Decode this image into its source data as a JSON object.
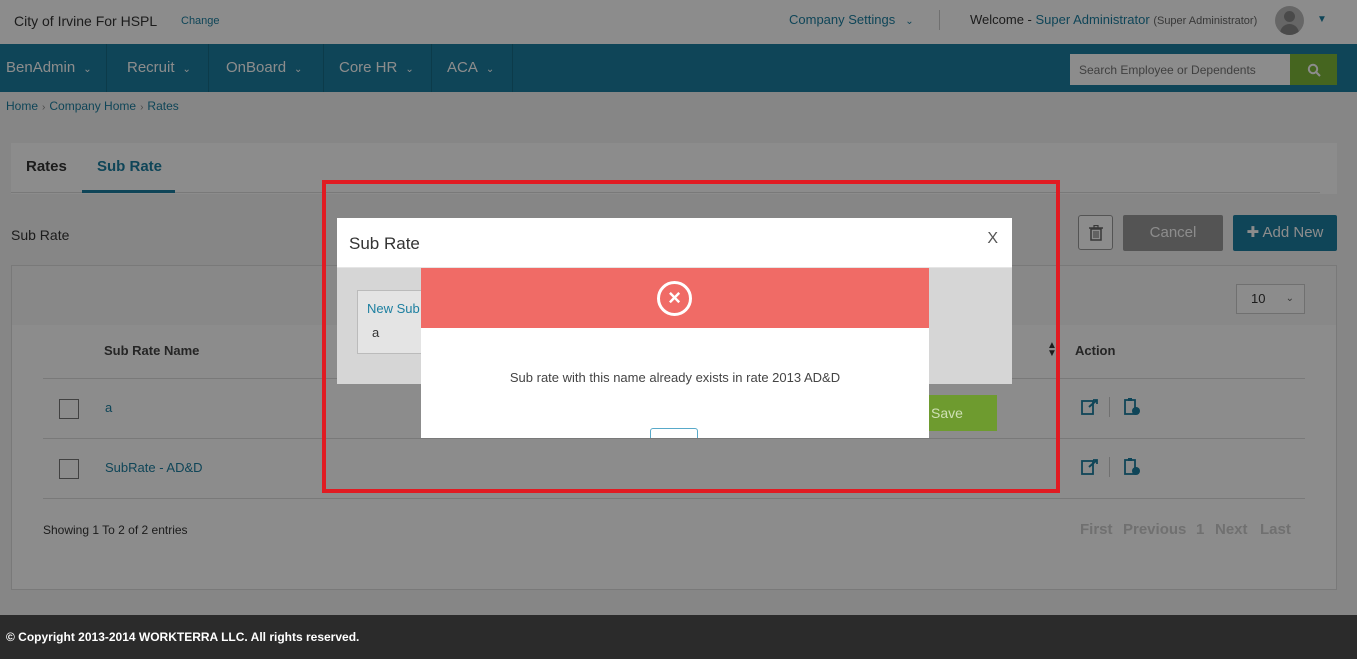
{
  "header": {
    "company_name": "City of Irvine For HSPL",
    "change_label": "Change",
    "company_settings_label": "Company Settings",
    "welcome_prefix": "Welcome -",
    "user_name": "Super Administrator",
    "user_role": "(Super Administrator)"
  },
  "nav": {
    "items": [
      {
        "label": "BenAdmin"
      },
      {
        "label": "Recruit"
      },
      {
        "label": "OnBoard"
      },
      {
        "label": "Core HR"
      },
      {
        "label": "ACA"
      }
    ],
    "search_placeholder": "Search Employee or Dependents"
  },
  "breadcrumb": [
    "Home",
    "Company Home",
    "Rates"
  ],
  "tabs": [
    {
      "label": "Rates",
      "active": false
    },
    {
      "label": "Sub Rate",
      "active": true
    }
  ],
  "page": {
    "section_title": "Sub Rate",
    "cancel_label": "Cancel",
    "add_new_label": "Add New"
  },
  "grid": {
    "page_size": "10",
    "columns": [
      "Sub Rate Name",
      "Action"
    ],
    "rows": [
      {
        "name": "a"
      },
      {
        "name": "SubRate - AD&D"
      }
    ],
    "showing_text": "Showing 1 To 2 of 2 entries",
    "pager": [
      "First",
      "Previous",
      "1",
      "Next",
      "Last"
    ]
  },
  "footer": {
    "copyright": "© Copyright 2013-2014 WORKTERRA LLC. All rights reserved."
  },
  "modal": {
    "title": "Sub Rate",
    "close_label": "X",
    "field_label": "New Sub",
    "field_value": "a",
    "save_label": "Save"
  },
  "alert": {
    "message": "Sub rate with this name already exists in rate 2013 AD&D",
    "color": "#f06b66"
  },
  "colors": {
    "primary": "#1c7fa0",
    "search_button": "#7fb83a",
    "highlight": "#e11b22"
  }
}
